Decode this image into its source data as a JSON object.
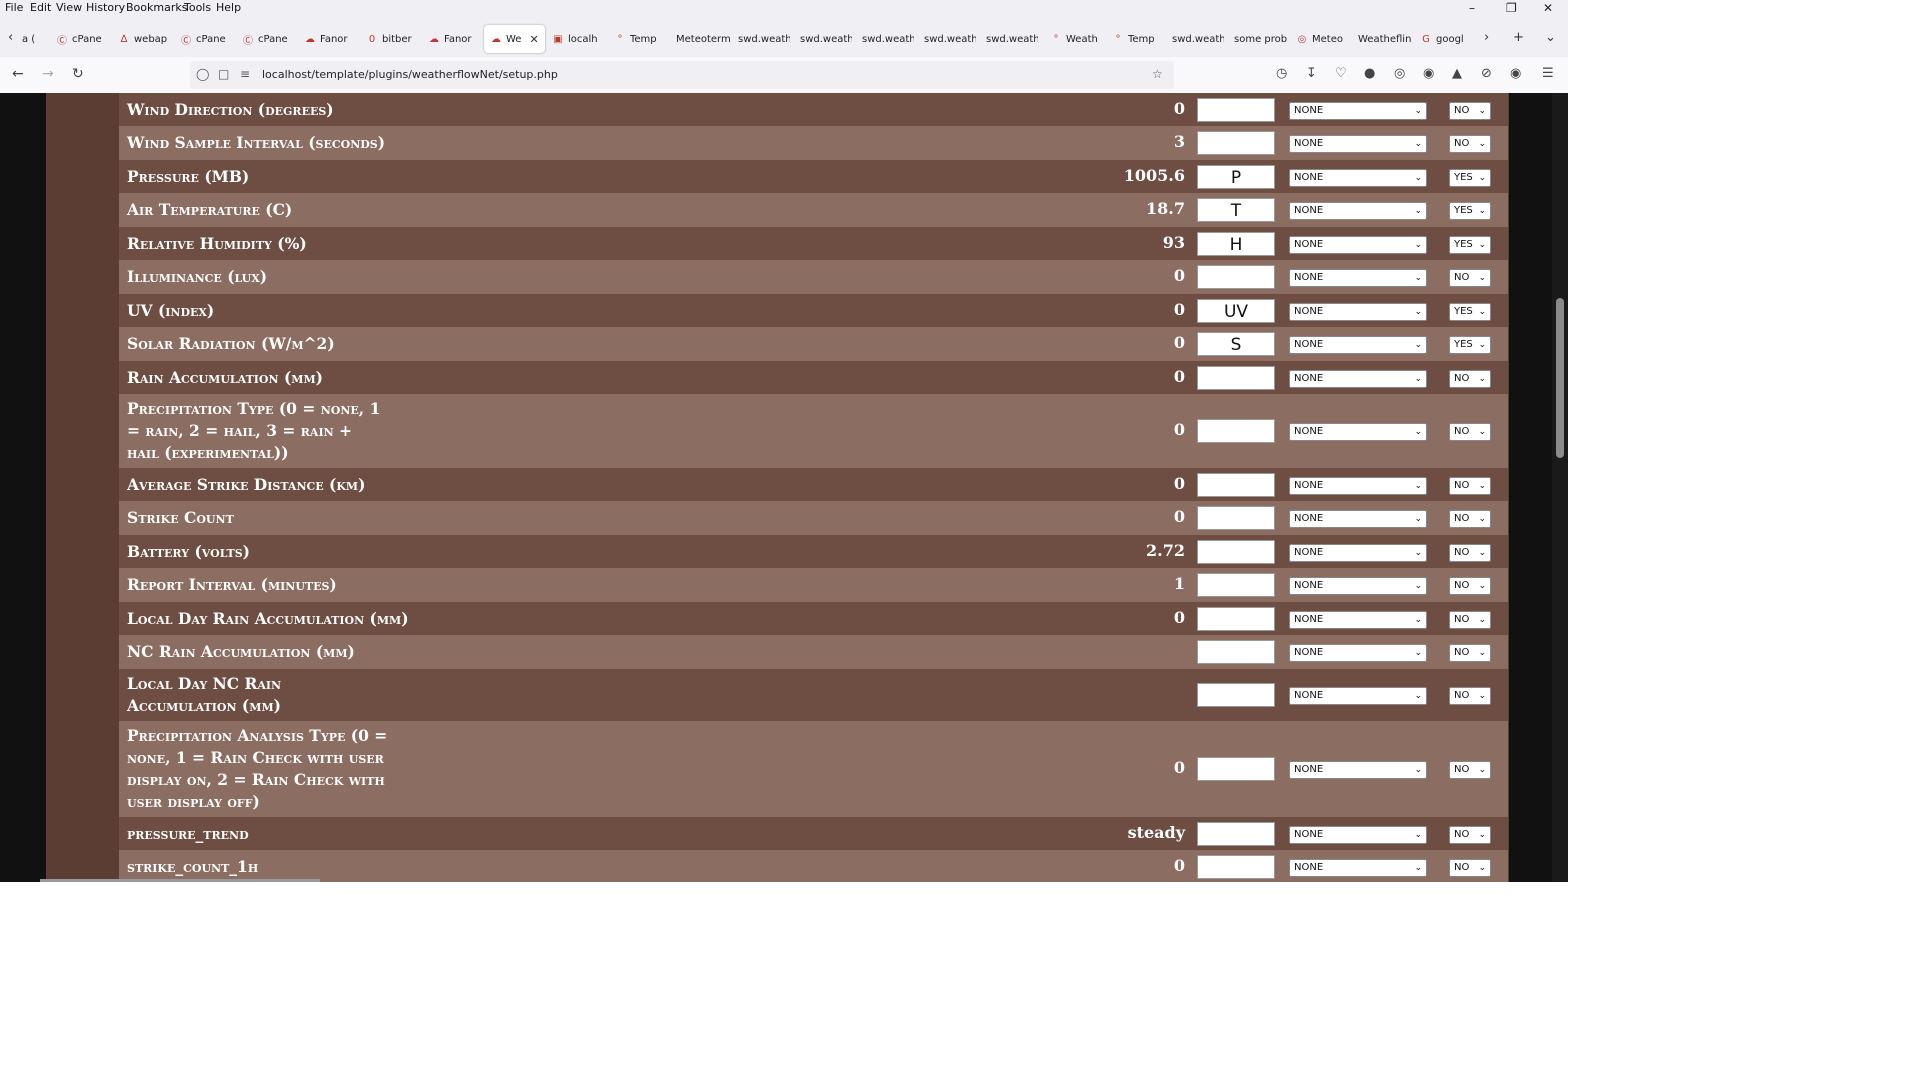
{
  "menu": [
    "File",
    "Edit",
    "View",
    "History",
    "Bookmarks",
    "Tools",
    "Help"
  ],
  "tabs": [
    {
      "label": "a (",
      "icon": ""
    },
    {
      "label": "cPane",
      "icon": "cpanel-icon"
    },
    {
      "label": "webap",
      "icon": "webapp-icon"
    },
    {
      "label": "cPane",
      "icon": "cpanel-icon"
    },
    {
      "label": "cPane",
      "icon": "cpanel-icon"
    },
    {
      "label": "Fanor",
      "icon": "weather-icon"
    },
    {
      "label": "bitber",
      "icon": "binary-icon"
    },
    {
      "label": "Fanor",
      "icon": "weather-icon"
    },
    {
      "label": "We",
      "icon": "weather-icon",
      "active": true
    },
    {
      "label": "localh",
      "icon": "page-icon"
    },
    {
      "label": "Temp",
      "icon": "temp-icon"
    },
    {
      "label": "Meteoterm",
      "icon": ""
    },
    {
      "label": "swd.weath",
      "icon": ""
    },
    {
      "label": "swd.weath",
      "icon": ""
    },
    {
      "label": "swd.weath",
      "icon": ""
    },
    {
      "label": "swd.weath",
      "icon": ""
    },
    {
      "label": "swd.weath",
      "icon": ""
    },
    {
      "label": "Weath",
      "icon": "temp-icon"
    },
    {
      "label": "Temp",
      "icon": "temp-icon"
    },
    {
      "label": "swd.weath",
      "icon": ""
    },
    {
      "label": "some prob",
      "icon": ""
    },
    {
      "label": "Meteo",
      "icon": "meteo-icon"
    },
    {
      "label": "Weatheflin",
      "icon": ""
    },
    {
      "label": "googl",
      "icon": "google-icon"
    }
  ],
  "url": "localhost/template/plugins/weatherflowNet/setup.php",
  "rows": [
    {
      "label": "Wind Direction (degrees)",
      "value": "0",
      "abbr": "",
      "select": "NONE",
      "yn": "NO"
    },
    {
      "label": "Wind Sample Interval (seconds)",
      "value": "3",
      "abbr": "",
      "select": "NONE",
      "yn": "NO"
    },
    {
      "label": "Pressure (MB)",
      "value": "1005.6",
      "abbr": "P",
      "select": "NONE",
      "yn": "YES"
    },
    {
      "label": "Air Temperature (C)",
      "value": "18.7",
      "abbr": "T",
      "select": "NONE",
      "yn": "YES"
    },
    {
      "label": "Relative Humidity (%)",
      "value": "93",
      "abbr": "H",
      "select": "NONE",
      "yn": "YES"
    },
    {
      "label": "Illuminance (lux)",
      "value": "0",
      "abbr": "",
      "select": "NONE",
      "yn": "NO"
    },
    {
      "label": "UV (index)",
      "value": "0",
      "abbr": "UV",
      "select": "NONE",
      "yn": "YES"
    },
    {
      "label": "Solar Radiation (W/m^2)",
      "value": "0",
      "abbr": "S",
      "select": "NONE",
      "yn": "YES"
    },
    {
      "label": "Rain Accumulation (mm)",
      "value": "0",
      "abbr": "",
      "select": "NONE",
      "yn": "NO"
    },
    {
      "label": "Precipitation Type (0 = none, 1 = rain, 2 = hail, 3 = rain + hail (experimental))",
      "value": "0",
      "abbr": "",
      "select": "NONE",
      "yn": "NO"
    },
    {
      "label": "Average Strike Distance (km)",
      "value": "0",
      "abbr": "",
      "select": "NONE",
      "yn": "NO"
    },
    {
      "label": "Strike Count",
      "value": "0",
      "abbr": "",
      "select": "NONE",
      "yn": "NO"
    },
    {
      "label": "Battery (volts)",
      "value": "2.72",
      "abbr": "",
      "select": "NONE",
      "yn": "NO"
    },
    {
      "label": "Report Interval (minutes)",
      "value": "1",
      "abbr": "",
      "select": "NONE",
      "yn": "NO"
    },
    {
      "label": "Local Day Rain Accumulation (mm)",
      "value": "0",
      "abbr": "",
      "select": "NONE",
      "yn": "NO"
    },
    {
      "label": "NC Rain Accumulation (mm)",
      "value": "",
      "abbr": "",
      "select": "NONE",
      "yn": "NO"
    },
    {
      "label": "Local Day NC Rain Accumulation (mm)",
      "value": "",
      "abbr": "",
      "select": "NONE",
      "yn": "NO"
    },
    {
      "label": "Precipitation Analysis Type (0 = none, 1 = Rain Check with user display on, 2 = Rain Check with user display off)",
      "value": "0",
      "abbr": "",
      "select": "NONE",
      "yn": "NO"
    },
    {
      "label": "pressure_trend",
      "value": "steady",
      "abbr": "",
      "select": "NONE",
      "yn": "NO"
    },
    {
      "label": "strike_count_1h",
      "value": "0",
      "abbr": "",
      "select": "NONE",
      "yn": "NO"
    }
  ],
  "colors": {
    "row_dark": "#6e4e42",
    "row_light": "#8c6d62",
    "frame": "#5b3d33"
  }
}
